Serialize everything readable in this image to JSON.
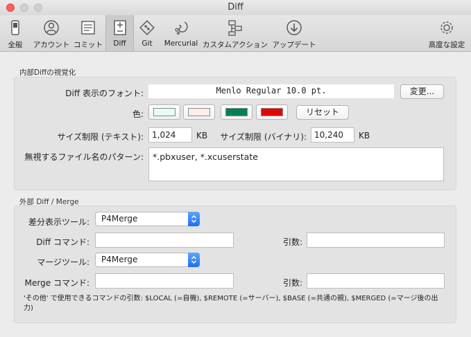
{
  "window": {
    "title": "Diff"
  },
  "toolbar": {
    "items": [
      {
        "label": "全般",
        "icon": "switch-icon"
      },
      {
        "label": "アカウント",
        "icon": "account-icon"
      },
      {
        "label": "コミット",
        "icon": "commit-icon"
      },
      {
        "label": "Diff",
        "icon": "diff-icon",
        "selected": true
      },
      {
        "label": "Git",
        "icon": "git-icon"
      },
      {
        "label": "Mercurial",
        "icon": "mercurial-icon"
      },
      {
        "label": "カスタムアクション",
        "icon": "custom-action-icon"
      },
      {
        "label": "アップデート",
        "icon": "update-icon"
      },
      {
        "label": "高度な設定",
        "icon": "gear-icon"
      }
    ]
  },
  "internal": {
    "group_title": "内部Diffの視覚化",
    "font_label": "Diff 表示のフォント:",
    "font_value": "Menlo Regular 10.0 pt.",
    "change_button": "変更...",
    "color_label": "色:",
    "colors": [
      "#e6fcf5",
      "#fdeee9",
      "#027f56",
      "#e30505"
    ],
    "reset_button": "リセット",
    "size_text_label": "サイズ制限 (テキスト):",
    "size_text_value": "1,024",
    "size_text_unit": "KB",
    "size_binary_label": "サイズ制限 (バイナリ):",
    "size_binary_value": "10,240",
    "size_binary_unit": "KB",
    "ignore_label": "無視するファイル名のパターン:",
    "ignore_value": "*.pbxuser, *.xcuserstate"
  },
  "external": {
    "group_title": "外部 Diff / Merge",
    "diff_tool_label": "差分表示ツール:",
    "diff_tool_value": "P4Merge",
    "diff_command_label": "Diff コマンド:",
    "diff_command_value": "",
    "diff_args_label": "引数:",
    "diff_args_value": "",
    "merge_tool_label": "マージツール:",
    "merge_tool_value": "P4Merge",
    "merge_command_label": "Merge コマンド:",
    "merge_command_value": "",
    "merge_args_label": "引数:",
    "merge_args_value": "",
    "note": "'その他' で使用できるコマンドの引数: $LOCAL (=自機), $REMOTE (=サーバー), $BASE (=共通の親), $MERGED (=マージ後の出力)"
  }
}
